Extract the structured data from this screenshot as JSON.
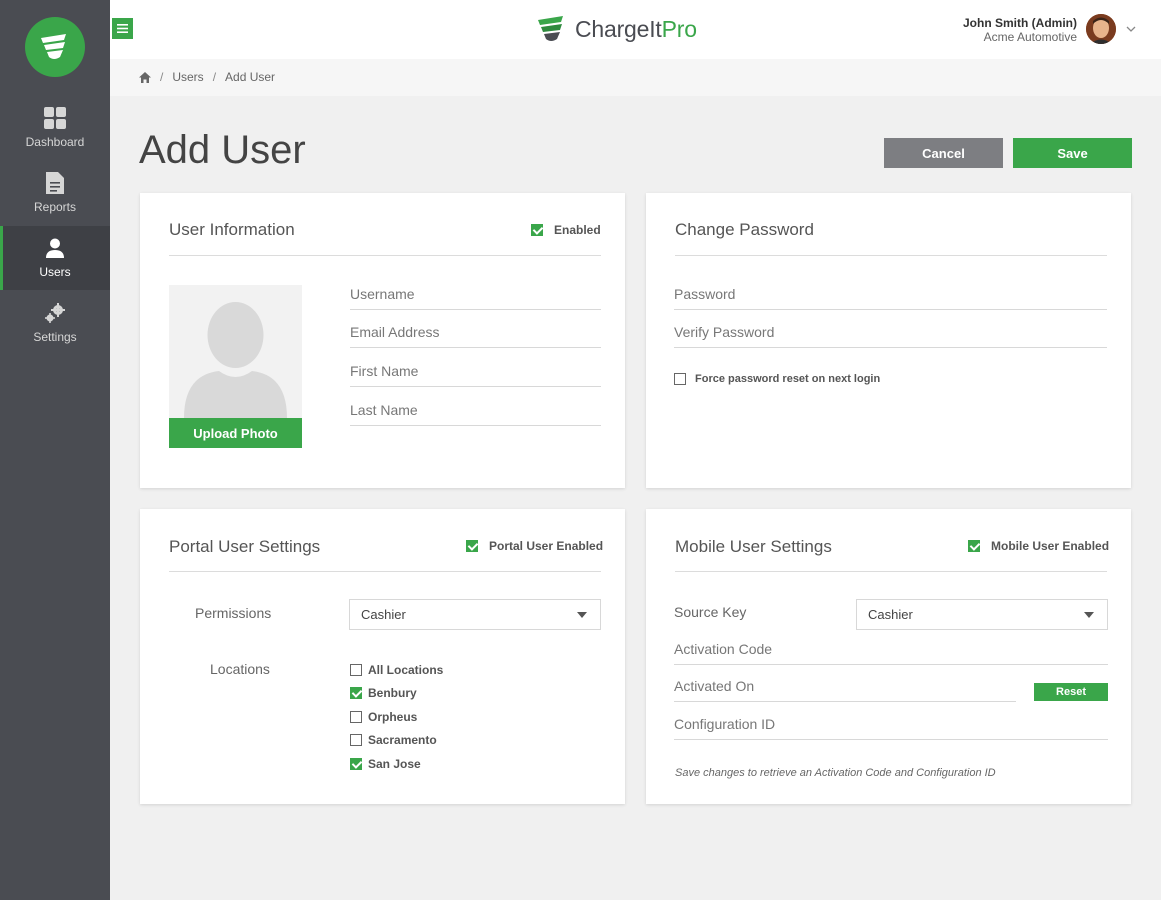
{
  "app": {
    "brand_main": "ChargeIt",
    "brand_accent": "Pro",
    "accent_color": "#3aa64a",
    "sidebar_color": "#4a4c52"
  },
  "sidebar": {
    "items": [
      {
        "label": "Dashboard",
        "icon": "dashboard-icon",
        "active": false
      },
      {
        "label": "Reports",
        "icon": "document-icon",
        "active": false
      },
      {
        "label": "Users",
        "icon": "user-icon",
        "active": true
      },
      {
        "label": "Settings",
        "icon": "gears-icon",
        "active": false
      }
    ]
  },
  "header": {
    "user_name": "John Smith (Admin)",
    "company": "Acme Automotive"
  },
  "breadcrumb": {
    "items": [
      "Users",
      "Add User"
    ]
  },
  "page": {
    "title": "Add User",
    "cancel_label": "Cancel",
    "save_label": "Save"
  },
  "user_info": {
    "title": "User Information",
    "enabled_label": "Enabled",
    "enabled": true,
    "upload_label": "Upload Photo",
    "fields": {
      "username": {
        "placeholder": "Username",
        "value": ""
      },
      "email": {
        "placeholder": "Email Address",
        "value": ""
      },
      "first_name": {
        "placeholder": "First Name",
        "value": ""
      },
      "last_name": {
        "placeholder": "Last Name",
        "value": ""
      }
    }
  },
  "change_password": {
    "title": "Change Password",
    "fields": {
      "password": {
        "placeholder": "Password",
        "value": ""
      },
      "verify": {
        "placeholder": "Verify Password",
        "value": ""
      }
    },
    "force_reset_label": "Force password reset on next login",
    "force_reset": false
  },
  "portal": {
    "title": "Portal User Settings",
    "enabled_label": "Portal User Enabled",
    "enabled": true,
    "permissions_label": "Permissions",
    "permissions_value": "Cashier",
    "locations_label": "Locations",
    "locations": [
      {
        "label": "All Locations",
        "checked": false
      },
      {
        "label": "Benbury",
        "checked": true
      },
      {
        "label": "Orpheus",
        "checked": false
      },
      {
        "label": "Sacramento",
        "checked": false
      },
      {
        "label": "San Jose",
        "checked": true
      }
    ]
  },
  "mobile": {
    "title": "Mobile User Settings",
    "enabled_label": "Mobile User Enabled",
    "enabled": true,
    "source_key_label": "Source Key",
    "source_key_value": "Cashier",
    "activation_code_placeholder": "Activation Code",
    "activated_on_placeholder": "Activated On",
    "configuration_id_placeholder": "Configuration ID",
    "reset_label": "Reset",
    "hint": "Save changes to retrieve an Activation Code and Configuration ID"
  }
}
